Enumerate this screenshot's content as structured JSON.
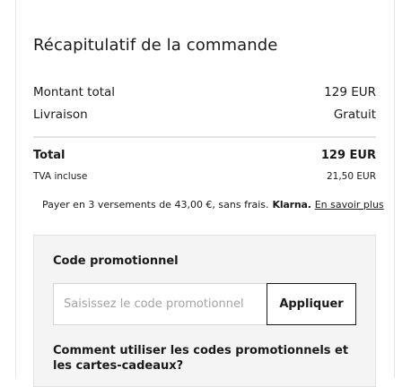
{
  "summary": {
    "title": "Récapitulatif de la commande",
    "rows": [
      {
        "label": "Montant total",
        "value": "129 EUR"
      },
      {
        "label": "Livraison",
        "value": "Gratuit"
      }
    ],
    "total": {
      "label": "Total",
      "value": "129 EUR"
    },
    "vat": {
      "label": "TVA incluse",
      "value": "21,50 EUR"
    }
  },
  "klarna": {
    "text": "Payer en 3 versements de 43,00 €, sans frais.",
    "brand": "Klarna.",
    "link": "En savoir plus"
  },
  "promo": {
    "title": "Code promotionnel",
    "input_value": "",
    "placeholder": "Saisissez le code promotionnel",
    "apply_label": "Appliquer",
    "help_title": "Comment utiliser les codes promotionnels et les cartes-cadeaux?"
  },
  "colors": {
    "text": "#1a1a1a",
    "divider": "#e3e3e3",
    "promo_bg": "#f4f4f4",
    "placeholder": "#a3a3a3"
  }
}
